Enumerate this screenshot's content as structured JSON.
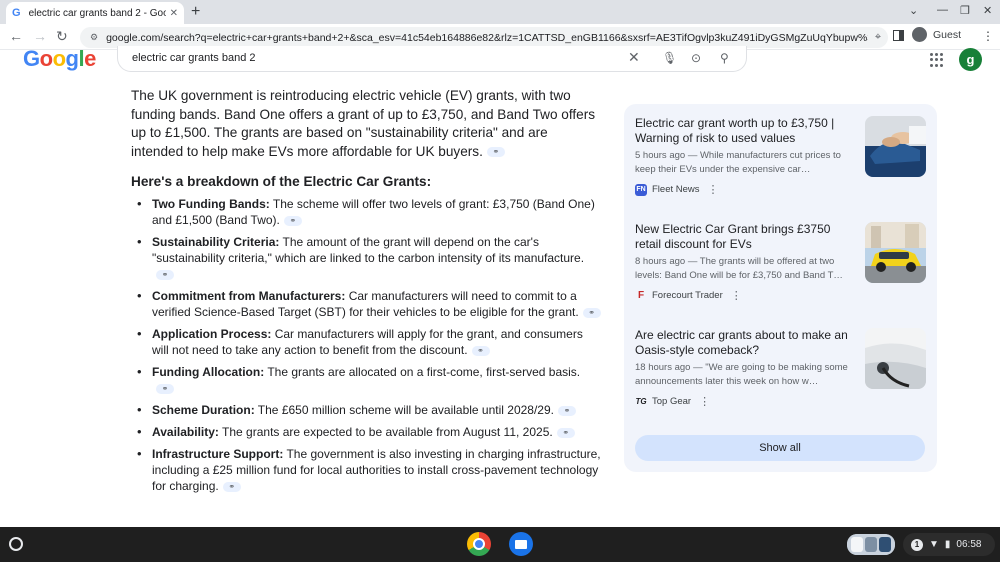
{
  "browser": {
    "tab_title": "electric car grants band 2 - Goog",
    "tab_favicon": "G",
    "url": "google.com/search?q=electric+car+grants+band+2+&sca_esv=41c54eb164886e82&rlz=1CATTSD_enGB1166&sxsrf=AE3TifOgvlp3kuZ491iDyGSMgZuUqYbupw%3...",
    "profile_label": "Guest",
    "icons": [
      "back-arrow-icon",
      "forward-arrow-icon",
      "reload-icon",
      "site-info-icon",
      "location-icon",
      "side-panel-icon",
      "menu-icon"
    ]
  },
  "google": {
    "logo_letters": [
      "G",
      "o",
      "o",
      "g",
      "l",
      "e"
    ],
    "logo_colors": [
      "#4285f4",
      "#ea4335",
      "#fbbc04",
      "#4285f4",
      "#34a853",
      "#ea4335"
    ],
    "query": "electric car grants band 2",
    "avatar_letter": "g"
  },
  "answer": {
    "intro": "The UK government is reintroducing electric vehicle (EV) grants, with two funding bands. Band One offers a grant of up to £3,750, and Band Two offers up to £1,500. The grants are based on \"sustainability criteria\" and are intended to help make EVs more affordable for UK buyers.",
    "heading": "Here's a breakdown of the Electric Car Grants:",
    "bullets": [
      {
        "term": "Two Funding Bands:",
        "text": " The scheme will offer two levels of grant: £3,750 (Band One) and £1,500 (Band Two)."
      },
      {
        "term": "Sustainability Criteria:",
        "text": " The amount of the grant will depend on the car's \"sustainability criteria,\" which are linked to the carbon intensity of its manufacture."
      },
      {
        "term": "Commitment from Manufacturers:",
        "text": " Car manufacturers will need to commit to a verified Science-Based Target (SBT) for their vehicles to be eligible for the grant."
      },
      {
        "term": "Application Process:",
        "text": " Car manufacturers will apply for the grant, and consumers will not need to take any action to benefit from the discount."
      },
      {
        "term": "Funding Allocation:",
        "text": " The grants are allocated on a first-come, first-served basis."
      },
      {
        "term": "Scheme Duration:",
        "text": " The £650 million scheme will be available until 2028/29."
      },
      {
        "term": "Availability:",
        "text": " The grants are expected to be available from August 11, 2025."
      },
      {
        "term": "Infrastructure Support:",
        "text": " The government is also investing in charging infrastructure, including a £25 million fund for local authorities to install cross-pavement technology for charging."
      }
    ]
  },
  "news": {
    "cards": [
      {
        "headline": "Electric car grant worth up to £3,750 | Warning of risk to used values",
        "snippet": "5 hours ago — While manufacturers cut prices to keep their EVs under the expensive car…",
        "source": "Fleet News",
        "source_badge": "FN",
        "badge_color": "#3b5cd6"
      },
      {
        "headline": "New Electric Car Grant brings £3750 retail discount for EVs",
        "snippet": "8 hours ago — The grants will be offered at two levels: Band One will be for £3,750 and Band T…",
        "source": "Forecourt Trader",
        "source_badge": "F",
        "badge_color": "#c62828"
      },
      {
        "headline": "Are electric car grants about to make an Oasis-style comeback?",
        "snippet": "18 hours ago — \"We are going to be making some announcements later this week on how w…",
        "source": "Top Gear",
        "source_badge": "TG",
        "badge_color": "#202124"
      }
    ],
    "show_all": "Show all"
  },
  "shelf": {
    "time": "06:58",
    "notification_count": "1"
  }
}
